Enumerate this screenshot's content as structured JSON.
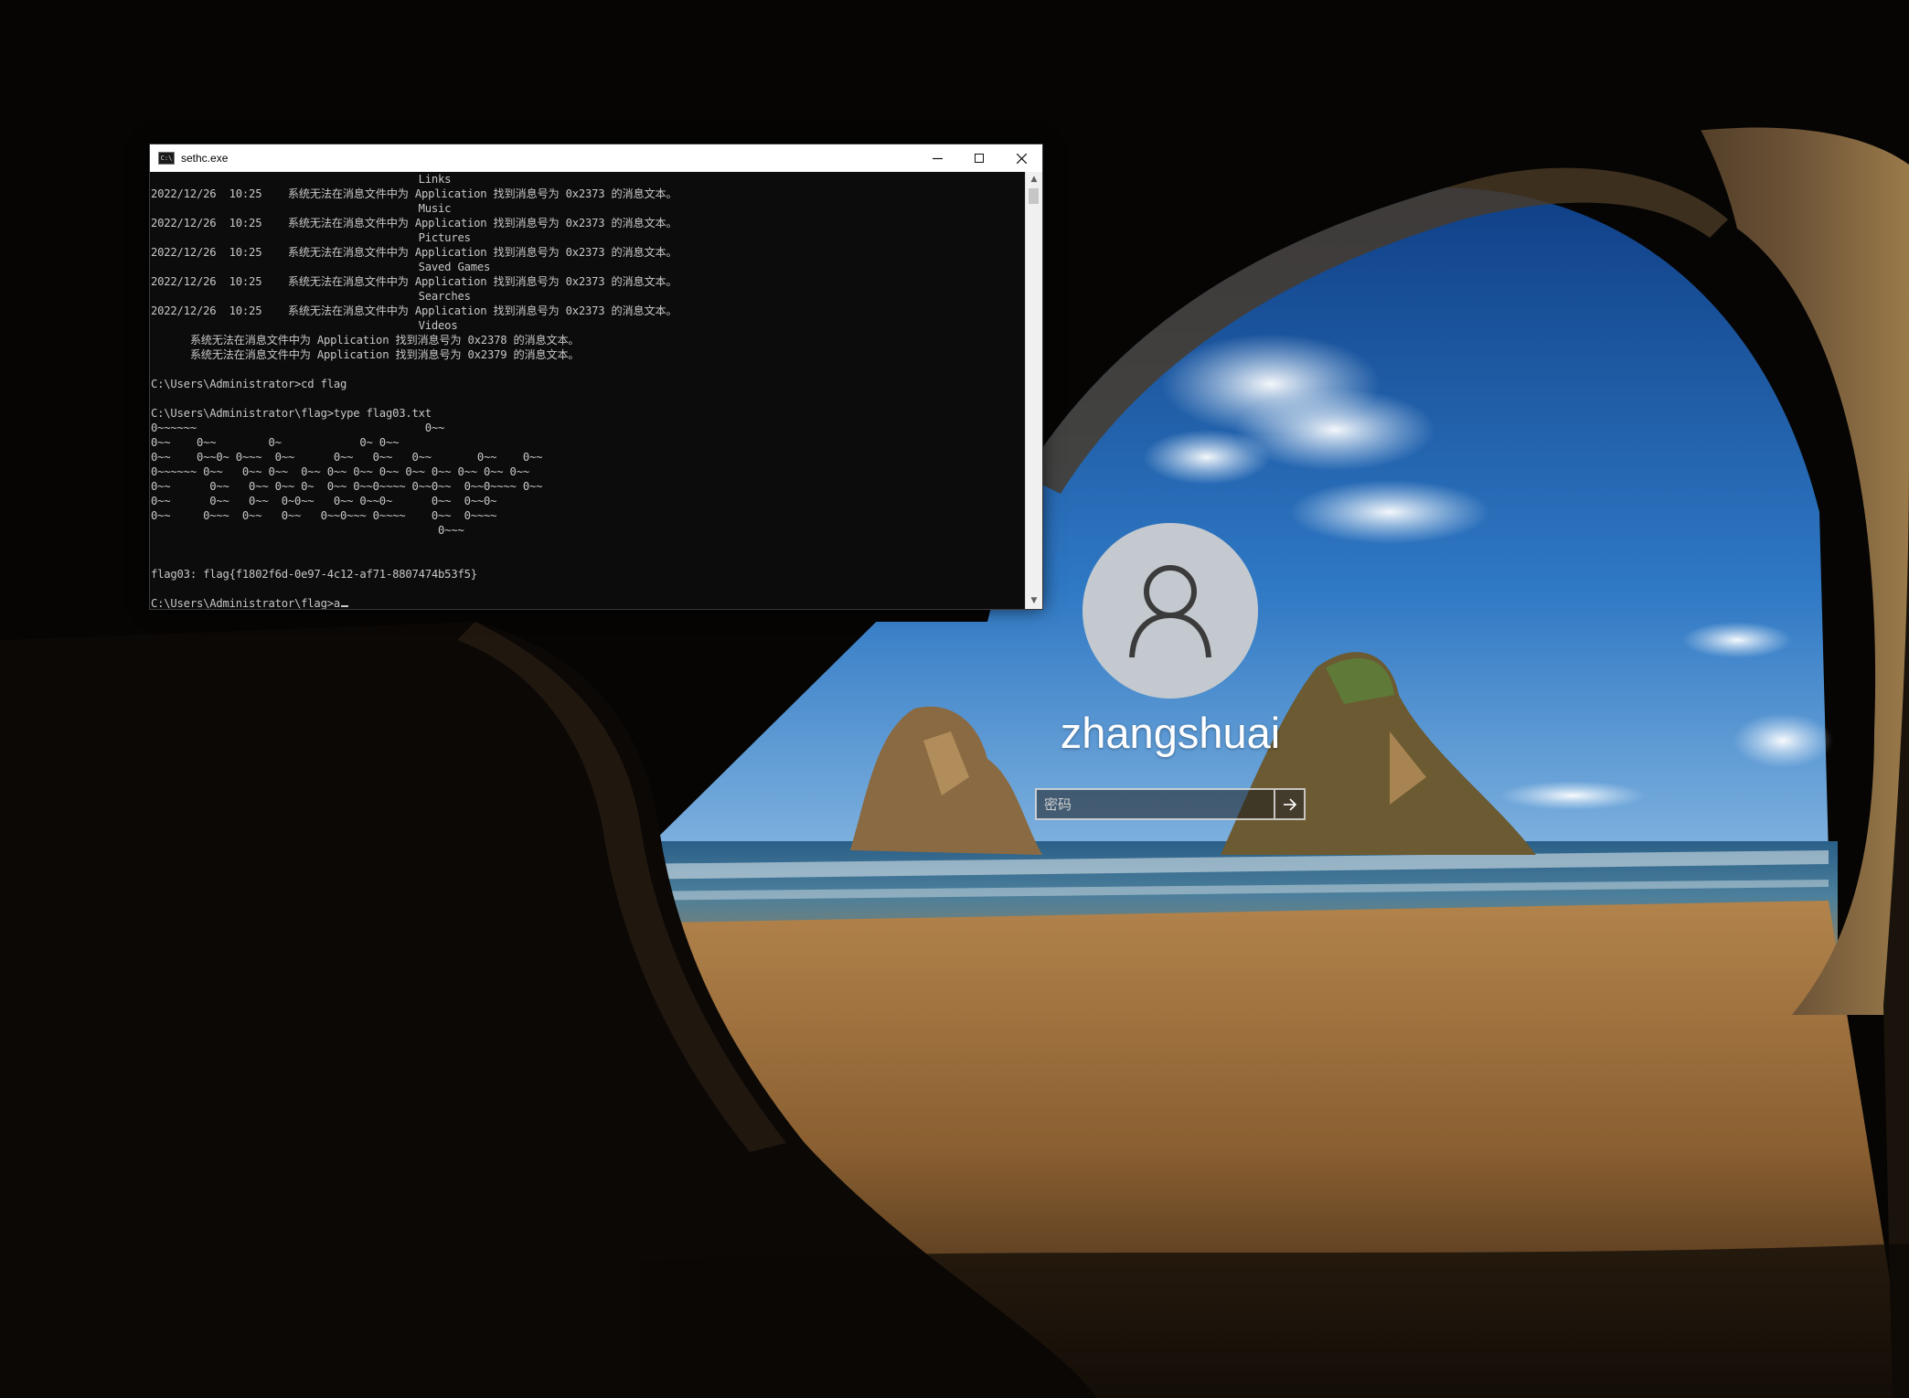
{
  "console": {
    "title": "sethc.exe",
    "icon": "console-icon",
    "controls": {
      "minimize": "minimize-icon",
      "maximize": "maximize-icon",
      "close": "close-icon"
    },
    "lines": [
      "                                         Links",
      "2022/12/26  10:25    系统无法在消息文件中为 Application 找到消息号为 0x2373 的消息文本。",
      "                                         Music",
      "2022/12/26  10:25    系统无法在消息文件中为 Application 找到消息号为 0x2373 的消息文本。",
      "                                         Pictures",
      "2022/12/26  10:25    系统无法在消息文件中为 Application 找到消息号为 0x2373 的消息文本。",
      "                                         Saved Games",
      "2022/12/26  10:25    系统无法在消息文件中为 Application 找到消息号为 0x2373 的消息文本。",
      "                                         Searches",
      "2022/12/26  10:25    系统无法在消息文件中为 Application 找到消息号为 0x2373 的消息文本。",
      "                                         Videos",
      "      系统无法在消息文件中为 Application 找到消息号为 0x2378 的消息文本。",
      "      系统无法在消息文件中为 Application 找到消息号为 0x2379 的消息文本。",
      "",
      "C:\\Users\\Administrator>cd flag",
      "",
      "C:\\Users\\Administrator\\flag>type flag03.txt",
      "0~~~~~~                                   0~~",
      "0~~    0~~        0~            0~ 0~~",
      "0~~    0~~0~ 0~~~  0~~      0~~   0~~   0~~       0~~    0~~",
      "0~~~~~~ 0~~   0~~ 0~~  0~~ 0~~ 0~~ 0~~ 0~~ 0~~ 0~~ 0~~ 0~~",
      "0~~      0~~   0~~ 0~~ 0~  0~~ 0~~0~~~~ 0~~0~~  0~~0~~~~ 0~~",
      "0~~      0~~   0~~  0~0~~   0~~ 0~~0~      0~~  0~~0~",
      "0~~     0~~~  0~~   0~~   0~~0~~~ 0~~~~    0~~  0~~~~",
      "                                            0~~~",
      "",
      "",
      "flag03: flag{f1802f6d-0e97-4c12-af71-8807474b53f5}",
      "",
      "C:\\Users\\Administrator\\flag>a"
    ]
  },
  "login": {
    "avatar_icon": "user-avatar-icon",
    "username": "zhangshuai",
    "password_placeholder": "密码",
    "submit_icon": "arrow-right-icon"
  }
}
